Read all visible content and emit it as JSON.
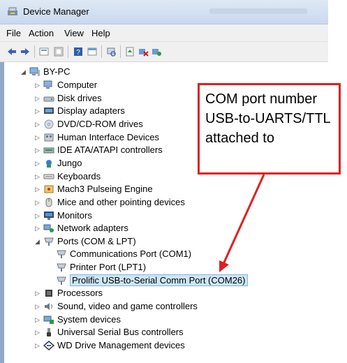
{
  "window": {
    "title": "Device Manager"
  },
  "menu": [
    "File",
    "Action",
    "View",
    "Help"
  ],
  "toolbar_icons": [
    "back-icon",
    "forward-icon",
    "properties-view-icon",
    "show-hide-icon",
    "help-icon",
    "view-icon",
    "scan-icon",
    "update-driver-icon",
    "uninstall-icon",
    "enable-icon"
  ],
  "tree": {
    "root": "BY-PC",
    "items": [
      {
        "label": "Computer",
        "icon": "computer-icon"
      },
      {
        "label": "Disk drives",
        "icon": "disk-icon"
      },
      {
        "label": "Display adapters",
        "icon": "display-icon"
      },
      {
        "label": "DVD/CD-ROM drives",
        "icon": "dvd-icon"
      },
      {
        "label": "Human Interface Devices",
        "icon": "hid-icon"
      },
      {
        "label": "IDE ATA/ATAPI controllers",
        "icon": "ide-icon"
      },
      {
        "label": "Jungo",
        "icon": "jungo-icon"
      },
      {
        "label": "Keyboards",
        "icon": "keyboard-icon"
      },
      {
        "label": "Mach3 Pulseing Engine",
        "icon": "mach3-icon"
      },
      {
        "label": "Mice and other pointing devices",
        "icon": "mouse-icon"
      },
      {
        "label": "Monitors",
        "icon": "monitor-icon"
      },
      {
        "label": "Network adapters",
        "icon": "network-icon"
      },
      {
        "label": "Ports (COM & LPT)",
        "icon": "port-icon"
      },
      {
        "label": "Communications Port (COM1)",
        "icon": "port-icon"
      },
      {
        "label": "Printer Port (LPT1)",
        "icon": "port-icon"
      },
      {
        "label": "Prolific USB-to-Serial Comm Port (COM26)",
        "icon": "port-icon"
      },
      {
        "label": "Processors",
        "icon": "processor-icon"
      },
      {
        "label": "Sound, video and game controllers",
        "icon": "sound-icon"
      },
      {
        "label": "System devices",
        "icon": "system-icon"
      },
      {
        "label": "Universal Serial Bus controllers",
        "icon": "usb-icon"
      },
      {
        "label": "WD Drive Management devices",
        "icon": "wd-icon"
      }
    ]
  },
  "annotation": {
    "lines": [
      "COM port number",
      "USB-to-UARTS/TTL",
      "attached to"
    ],
    "color": "#e02020"
  }
}
